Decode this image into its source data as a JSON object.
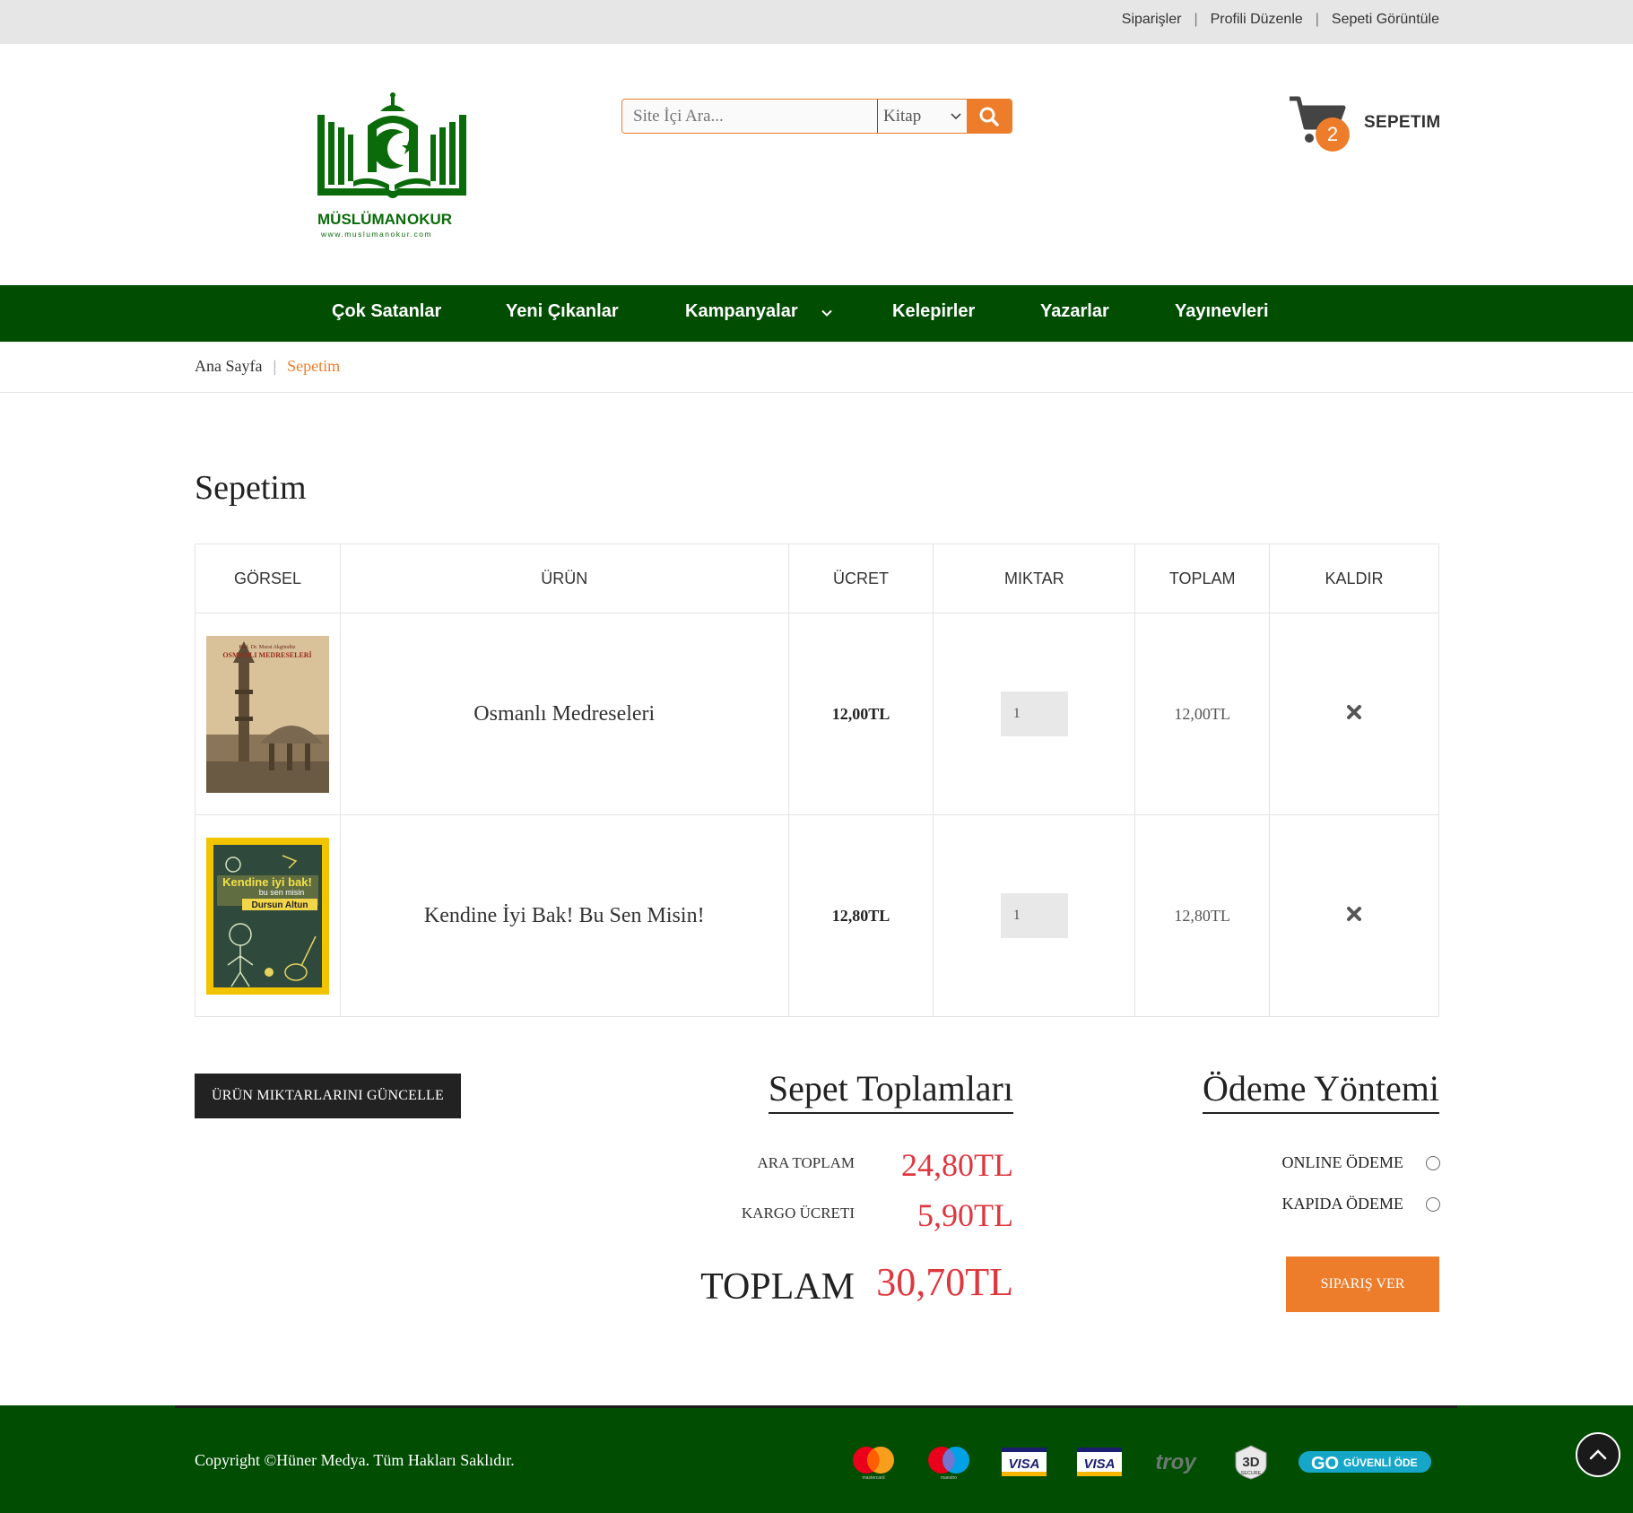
{
  "topbar": {
    "links": [
      "Siparişler",
      "Profili Düzenle",
      "Sepeti Görüntüle"
    ]
  },
  "brand": {
    "name_part1": "MÜSLÜMAN",
    "name_part2": "OKUR",
    "url": "www.muslumanokur.com",
    "color": "#0b6b0b"
  },
  "search": {
    "placeholder": "Site İçi Ara...",
    "category": "Kitap"
  },
  "cart": {
    "count": "2",
    "label": "SEPETIM"
  },
  "nav": {
    "items": [
      "Çok Satanlar",
      "Yeni Çıkanlar",
      "Kampanyalar",
      "Kelepirler",
      "Yazarlar",
      "Yayınevleri"
    ]
  },
  "breadcrumb": {
    "home": "Ana Sayfa",
    "current": "Sepetim"
  },
  "page_title": "Sepetim",
  "table": {
    "headers": [
      "GÖRSEL",
      "ÜRÜN",
      "ÜCRET",
      "MIKTAR",
      "TOPLAM",
      "KALDIR"
    ],
    "rows": [
      {
        "name": "Osmanlı Medreseleri",
        "price": "12,00TL",
        "qty": "1",
        "total": "12,00TL",
        "cover_title": "OSMANLI MEDRESELERİ",
        "cover_author": "Prof. Dr. Murat Akgündüz"
      },
      {
        "name": "Kendine İyi Bak! Bu Sen Misin!",
        "price": "12,80TL",
        "qty": "1",
        "total": "12,80TL",
        "cover_title": "Kendine iyi bak!",
        "cover_sub": "bu sen misin",
        "cover_author": "Dursun Altun"
      }
    ]
  },
  "update_button": "ÜRÜN MIKTARLARINI GÜNCELLE",
  "totals": {
    "title": "Sepet Toplamları",
    "subtotal_label": "ARA TOPLAM",
    "subtotal": "24,80TL",
    "shipping_label": "KARGO ÜCRETI",
    "shipping": "5,90TL",
    "total_label": "TOPLAM",
    "total": "30,70TL"
  },
  "payment": {
    "title": "Ödeme Yöntemi",
    "options": [
      "ONLINE ÖDEME",
      "KAPIDA ÖDEME"
    ],
    "order_button": "SIPARIŞ VER"
  },
  "footer": {
    "copyright": "Copyright ©Hüner Medya. Tüm Hakları Saklıdır.",
    "payment_icons": [
      "mastercard-icon",
      "maestro-icon",
      "visa-icon",
      "visa-icon",
      "troy-icon",
      "3d-secure-icon",
      "go-guvenli-ode-icon"
    ],
    "labels": {
      "mastercard": "mastercard",
      "maestro": "maestro",
      "visa": "VISA",
      "troy": "troy",
      "secure_3d": "3D",
      "secure_word": "SECURE",
      "go": "GO",
      "guvenli": "GÜVENLİ ÖDE"
    }
  },
  "colors": {
    "green": "#014d02",
    "orange": "#ee7d2b",
    "price_red": "#e0373f"
  }
}
